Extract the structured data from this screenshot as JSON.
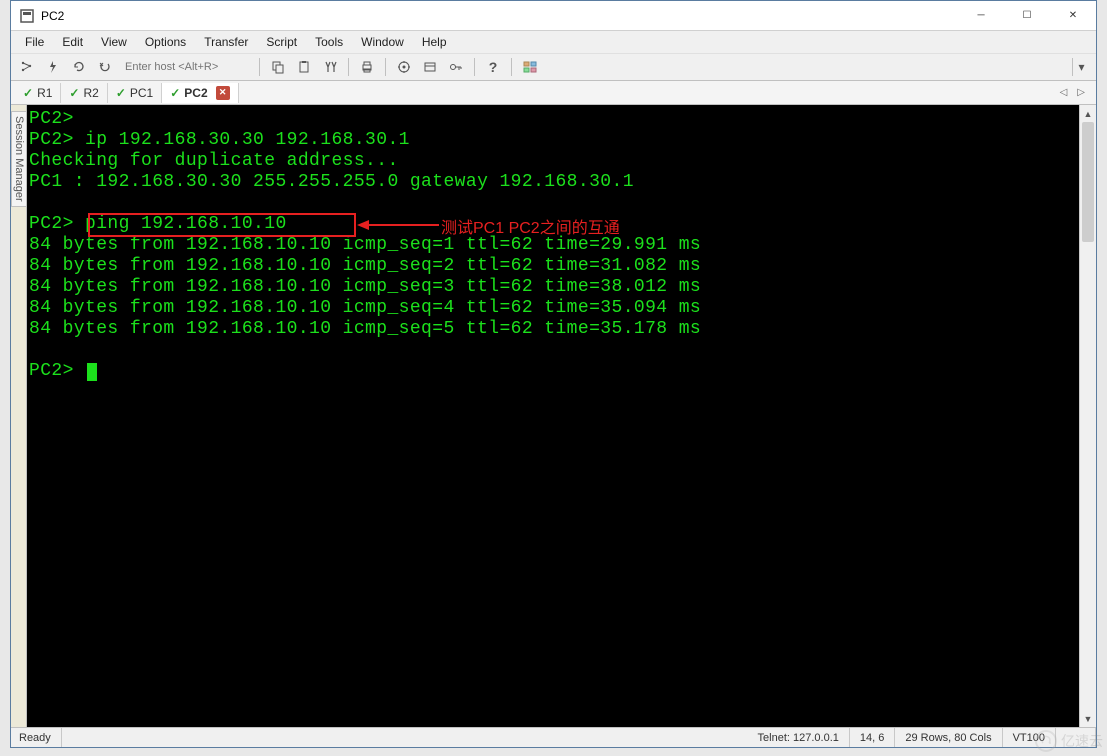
{
  "window": {
    "title": "PC2"
  },
  "menu": {
    "items": [
      "File",
      "Edit",
      "View",
      "Options",
      "Transfer",
      "Script",
      "Tools",
      "Window",
      "Help"
    ]
  },
  "toolbar": {
    "host_placeholder": "Enter host <Alt+R>"
  },
  "tabs": {
    "items": [
      {
        "label": "R1",
        "active": false
      },
      {
        "label": "R2",
        "active": false
      },
      {
        "label": "PC1",
        "active": false
      },
      {
        "label": "PC2",
        "active": true
      }
    ]
  },
  "sidebar": {
    "label": "Session Manager"
  },
  "terminal": {
    "lines": [
      "PC2>",
      "PC2> ip 192.168.30.30 192.168.30.1",
      "Checking for duplicate address...",
      "PC1 : 192.168.30.30 255.255.255.0 gateway 192.168.30.1",
      "",
      "PC2> ping 192.168.10.10",
      "84 bytes from 192.168.10.10 icmp_seq=1 ttl=62 time=29.991 ms",
      "84 bytes from 192.168.10.10 icmp_seq=2 ttl=62 time=31.082 ms",
      "84 bytes from 192.168.10.10 icmp_seq=3 ttl=62 time=38.012 ms",
      "84 bytes from 192.168.10.10 icmp_seq=4 ttl=62 time=35.094 ms",
      "84 bytes from 192.168.10.10 icmp_seq=5 ttl=62 time=35.178 ms",
      "",
      "PC2> "
    ]
  },
  "annotation": {
    "text": "测试PC1 PC2之间的互通"
  },
  "status": {
    "ready": "Ready",
    "conn": "Telnet: 127.0.0.1",
    "pos": "14,   6",
    "size": "29 Rows, 80 Cols",
    "term": "VT100"
  },
  "watermark": {
    "text": "亿速云"
  }
}
